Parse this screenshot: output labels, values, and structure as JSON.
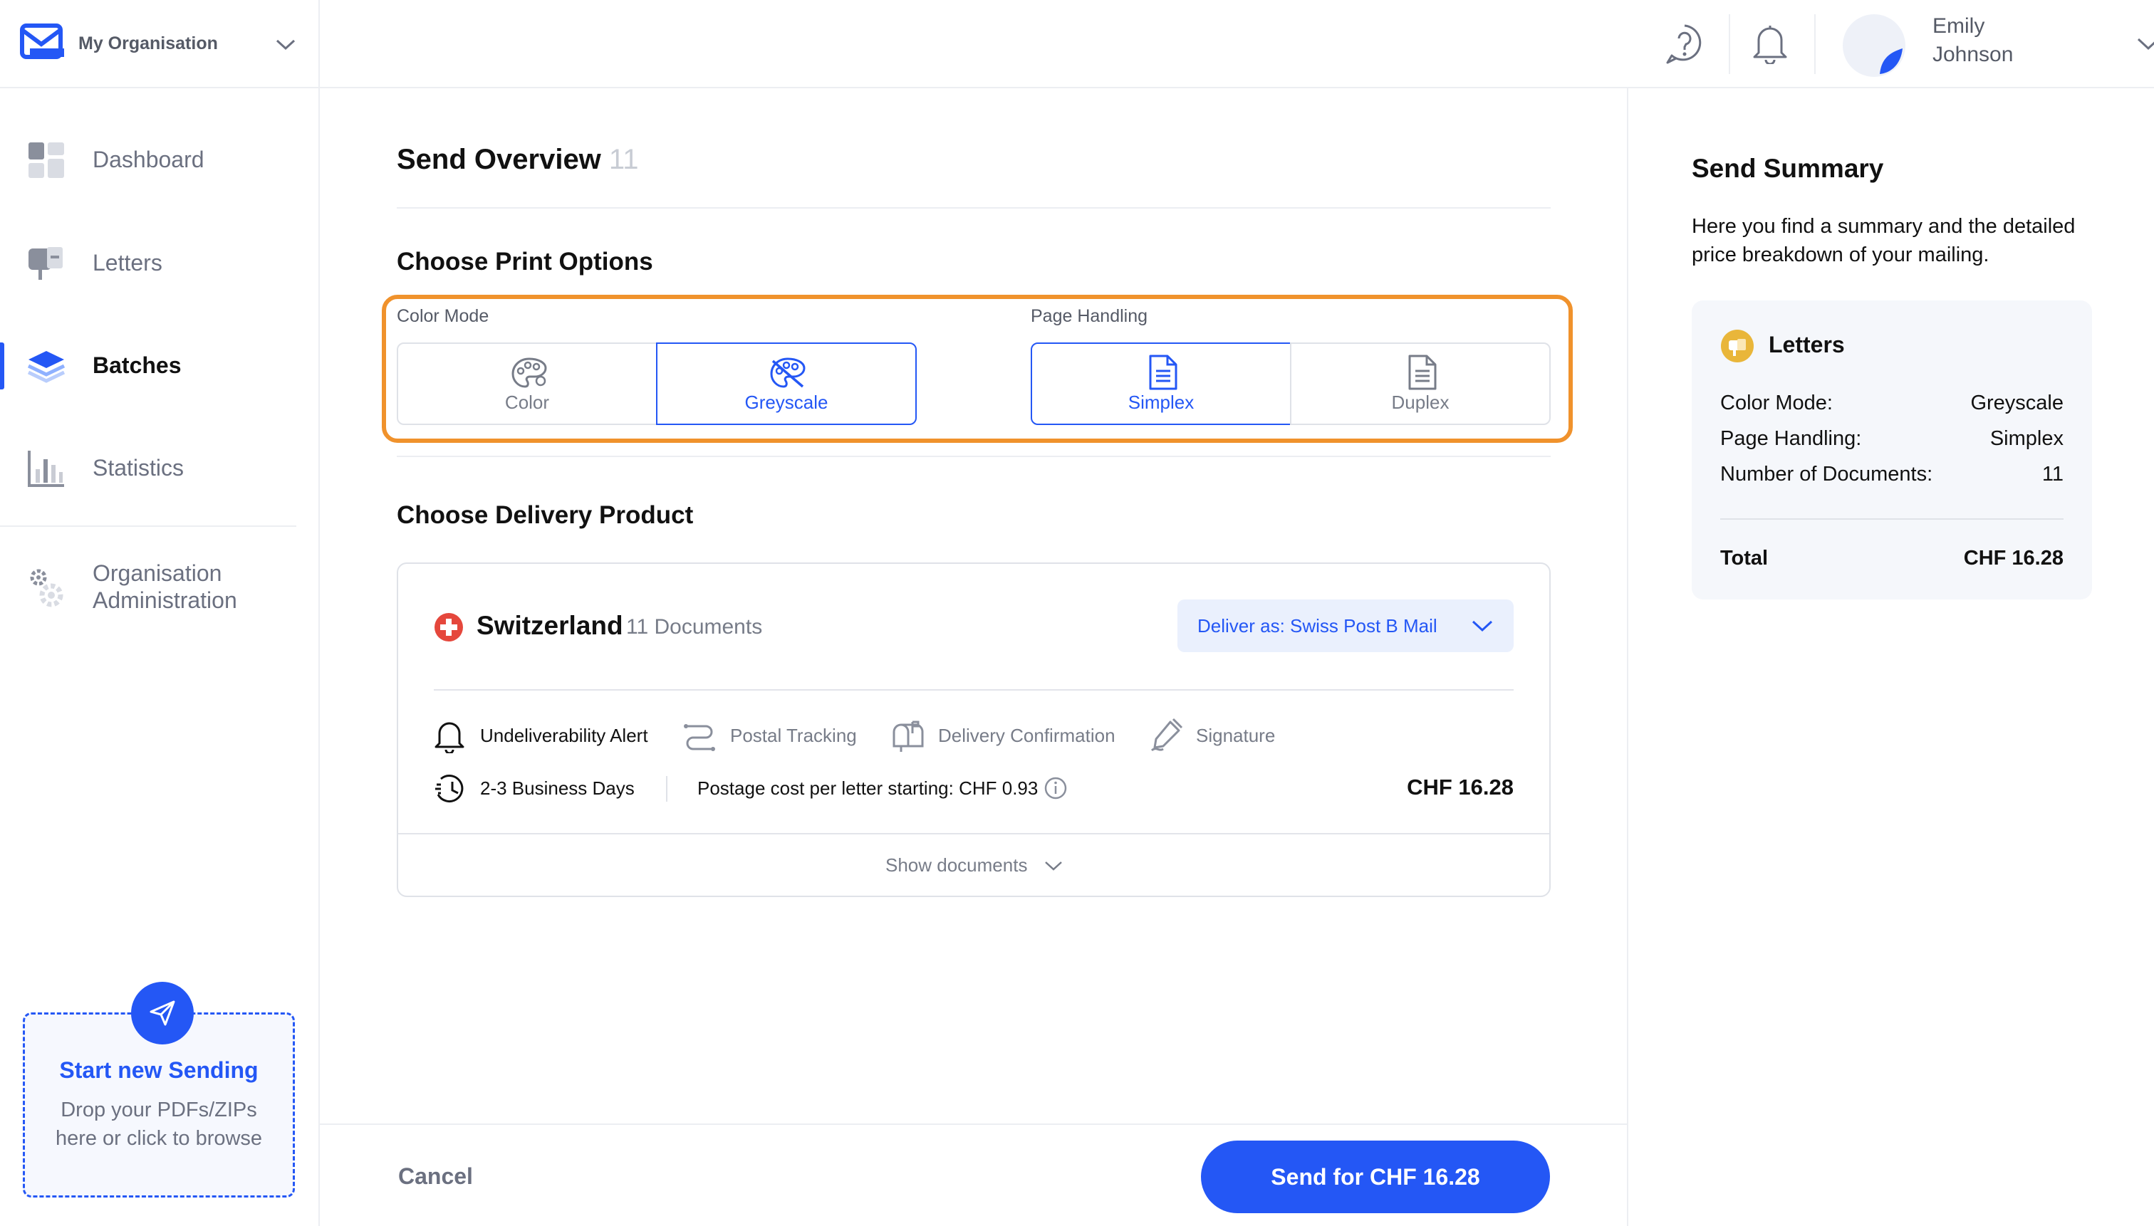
{
  "org": {
    "name": "My Organisation"
  },
  "sidebar": {
    "items": [
      {
        "label": "Dashboard"
      },
      {
        "label": "Letters"
      },
      {
        "label": "Batches"
      },
      {
        "label": "Statistics"
      },
      {
        "label": "Organisation Administration"
      }
    ],
    "upload": {
      "title": "Start new Sending",
      "line1": "Drop your PDFs/ZIPs",
      "line2": "here or click to browse"
    }
  },
  "user": {
    "first_name": "Emily",
    "last_name": "Johnson"
  },
  "main": {
    "title": "Send Overview",
    "count": "11",
    "print_options_title": "Choose Print Options",
    "color_mode_label": "Color Mode",
    "color_mode_options": [
      "Color",
      "Greyscale"
    ],
    "color_mode_selected": "Greyscale",
    "page_handling_label": "Page Handling",
    "page_handling_options": [
      "Simplex",
      "Duplex"
    ],
    "page_handling_selected": "Simplex",
    "delivery_title": "Choose Delivery Product",
    "delivery": {
      "country": "Switzerland",
      "documents": "11 Documents",
      "deliver_as": "Deliver as: Swiss Post B Mail",
      "features": [
        {
          "label": "Undeliverability Alert",
          "active": true
        },
        {
          "label": "Postal Tracking",
          "active": false
        },
        {
          "label": "Delivery Confirmation",
          "active": false
        },
        {
          "label": "Signature",
          "active": false
        }
      ],
      "business_days": "2-3 Business Days",
      "postage": "Postage cost per letter starting: CHF 0.93",
      "price": "CHF 16.28",
      "show_documents": "Show documents"
    }
  },
  "summary": {
    "title": "Send Summary",
    "desc_line1": "Here you find a summary and the detailed",
    "desc_line2": "price breakdown of your mailing.",
    "card_title": "Letters",
    "rows": [
      {
        "label": "Color Mode:",
        "value": "Greyscale"
      },
      {
        "label": "Page Handling:",
        "value": "Simplex"
      },
      {
        "label": "Number of Documents:",
        "value": "11"
      }
    ],
    "total_label": "Total",
    "total_value": "CHF 16.28"
  },
  "footer": {
    "cancel": "Cancel",
    "send": "Send for CHF 16.28"
  },
  "colors": {
    "accent": "#2457f5",
    "highlight": "#f0922c",
    "swiss_red": "#e5473c",
    "letters_icon": "#e9b63a"
  },
  "icons": [
    "logo-mail-icon",
    "chevron-down-icon",
    "dashboard-icon",
    "letters-icon",
    "batches-icon",
    "statistics-icon",
    "gear-icon",
    "help-icon",
    "bell-icon",
    "avatar",
    "palette-icon",
    "palette-off-icon",
    "document-icon",
    "swiss-flag-icon",
    "route-icon",
    "mailbox-icon",
    "signature-icon",
    "clock-icon",
    "info-icon",
    "send-icon"
  ]
}
